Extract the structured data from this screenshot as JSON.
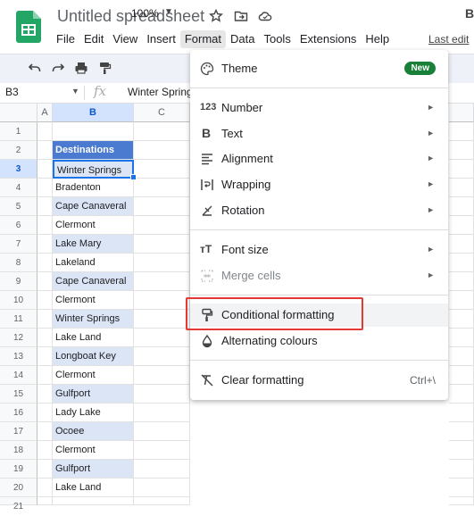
{
  "header": {
    "title": "Untitled spreadsheet",
    "last_edit": "Last edit",
    "menus": [
      "File",
      "Edit",
      "View",
      "Insert",
      "Format",
      "Data",
      "Tools",
      "Extensions",
      "Help"
    ],
    "active_menu": "Format"
  },
  "toolbar": {
    "zoom": "100%"
  },
  "formula_bar": {
    "cell_ref": "B3",
    "fx": "fx",
    "value": "Winter Spring"
  },
  "grid": {
    "columns": [
      "A",
      "B",
      "C"
    ],
    "rows": [
      "1",
      "2",
      "3",
      "4",
      "5",
      "6",
      "7",
      "8",
      "9",
      "10",
      "11",
      "12",
      "13",
      "14",
      "15",
      "16",
      "17",
      "18",
      "19",
      "20",
      "21"
    ],
    "header_cell": "Destinations",
    "values": [
      "Winter Springs",
      "Bradenton",
      "Cape Canaveral",
      "Clermont",
      "Lake Mary",
      "Lakeland",
      "Cape Canaveral",
      "Clermont",
      "Winter Springs",
      "Lake Land",
      "Longboat Key",
      "Clermont",
      "Gulfport",
      "Lady Lake",
      "Ocoee",
      "Clermont",
      "Gulfport",
      "Lake Land"
    ],
    "active_cell": "B3"
  },
  "format_menu": {
    "theme": "Theme",
    "new_badge": "New",
    "number": "Number",
    "text": "Text",
    "alignment": "Alignment",
    "wrapping": "Wrapping",
    "rotation": "Rotation",
    "font_size": "Font size",
    "merge_cells": "Merge cells",
    "conditional_formatting": "Conditional formatting",
    "alternating_colours": "Alternating colours",
    "clear_formatting": "Clear formatting",
    "clear_shortcut": "Ctrl+\\",
    "number_icon_text": "123",
    "text_icon_text": "B",
    "font_size_icon_text": "тT"
  },
  "colors": {
    "accent": "#1a73e8",
    "header_fill": "#4a7bd0",
    "band_fill": "#dbe5f5",
    "highlight_outline": "#e53935",
    "new_badge": "#188038"
  },
  "icons": [
    "sheets-logo",
    "star-icon",
    "move-folder-icon",
    "cloud-icon",
    "undo-icon",
    "redo-icon",
    "print-icon",
    "paint-format-icon",
    "palette-icon",
    "wrap-icon",
    "rotation-icon",
    "merge-icon",
    "paint-roller-icon",
    "fill-drop-icon",
    "clear-format-icon"
  ]
}
